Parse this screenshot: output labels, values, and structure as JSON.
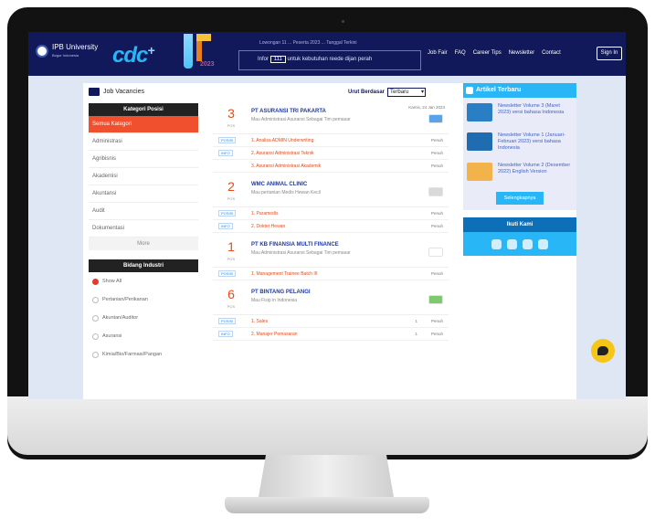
{
  "brand": {
    "name": "IPB University",
    "tagline": "Bogor Indonesia"
  },
  "logos": {
    "cdc": "cdc",
    "jf_year": "2023"
  },
  "ticker": {
    "top_text": "Lowongan 11 ... Peserta 2023 ... Tanggal Terkini",
    "prefix": "Infor",
    "number": "111",
    "suffix": "untuk kebutuhan reede dijan perah"
  },
  "nav": {
    "items": [
      "Job Fair",
      "FAQ",
      "Career Tips",
      "Newsletter",
      "Contact"
    ],
    "signin": "Sign In"
  },
  "jobs_header": {
    "title": "Job Vacancies",
    "sort_label": "Urut Berdasar",
    "sort_value": "Terbaru"
  },
  "kategori": {
    "title": "Kategori Posisi",
    "items": [
      "Semua Kategori",
      "Administrasi",
      "Agribisnis",
      "Akademisi",
      "Akuntansi",
      "Audit",
      "Dokumentasi"
    ],
    "more": "More"
  },
  "bidang": {
    "title": "Bidang Industri",
    "items": [
      "Show All",
      "Pertanian/Perikanan",
      "Akuntan/Auditor",
      "Asuransi",
      "Kimia/Bio/Farmasi/Pangan"
    ]
  },
  "jobs": [
    {
      "count": "3",
      "unit": "POS",
      "company": "PT ASURANSI TRI PAKARTA",
      "desc": "Mau Administrasi Asuransi Sebagai Tim pemasar",
      "date": "Kamis, 24 Jan 2023",
      "logo_color": "#5aa3e8",
      "positions": [
        {
          "name": "1. Analisa ADMIN Underwriting",
          "type": "Penuh"
        },
        {
          "name": "2. Asuransi Administrasi Teknik",
          "type": "Penuh"
        },
        {
          "name": "3. Asuransi Administrasi Akademik",
          "type": "Penuh"
        }
      ]
    },
    {
      "count": "2",
      "unit": "POS",
      "company": "WMC ANIMAL CLINIC",
      "desc": "Mau pertanian Medis Hewan Kecil",
      "date": "",
      "logo_color": "#d9d9d9",
      "positions": [
        {
          "name": "1. Paramedis",
          "type": "Penuh"
        },
        {
          "name": "2. Dokter Hewan",
          "type": "Penuh"
        }
      ]
    },
    {
      "count": "1",
      "unit": "POS",
      "company": "PT KB FINANSIA MULTI FINANCE",
      "desc": "Mau Administrasi Asuransi Sebagai Tim pemasar",
      "date": "",
      "logo_color": "#ffffff",
      "positions": [
        {
          "name": "1. Management Trainee Batch III",
          "type": "Penuh"
        }
      ]
    },
    {
      "count": "6",
      "unit": "POS",
      "company": "PT BINTANG PELANGI",
      "desc": "Mau Fisip in Indonesia",
      "date": "",
      "logo_color": "#7dc96b",
      "positions": [
        {
          "name": "1. Sales",
          "type": "Penuh",
          "slots": "1"
        },
        {
          "name": "2. Manajer Pemasaran",
          "type": "Penuh",
          "slots": "1"
        }
      ]
    }
  ],
  "articles": {
    "title": "Artikel Terbaru",
    "items": [
      {
        "title": "Newsletter Volume 3 (Maret 2023) versi bahasa Indonesia",
        "thumb": "#2a7fc4"
      },
      {
        "title": "Newsletter Volume 1 (Januari-Februari 2023) versi bahasa Indonesia",
        "thumb": "#1f6db0"
      },
      {
        "title": "Newsletter Volume 2 (Desember 2022) English Version",
        "thumb": "#f1b34a"
      }
    ],
    "see_all": "Selengkapnya"
  },
  "ikuti": {
    "title": "Ikuti Kami"
  }
}
